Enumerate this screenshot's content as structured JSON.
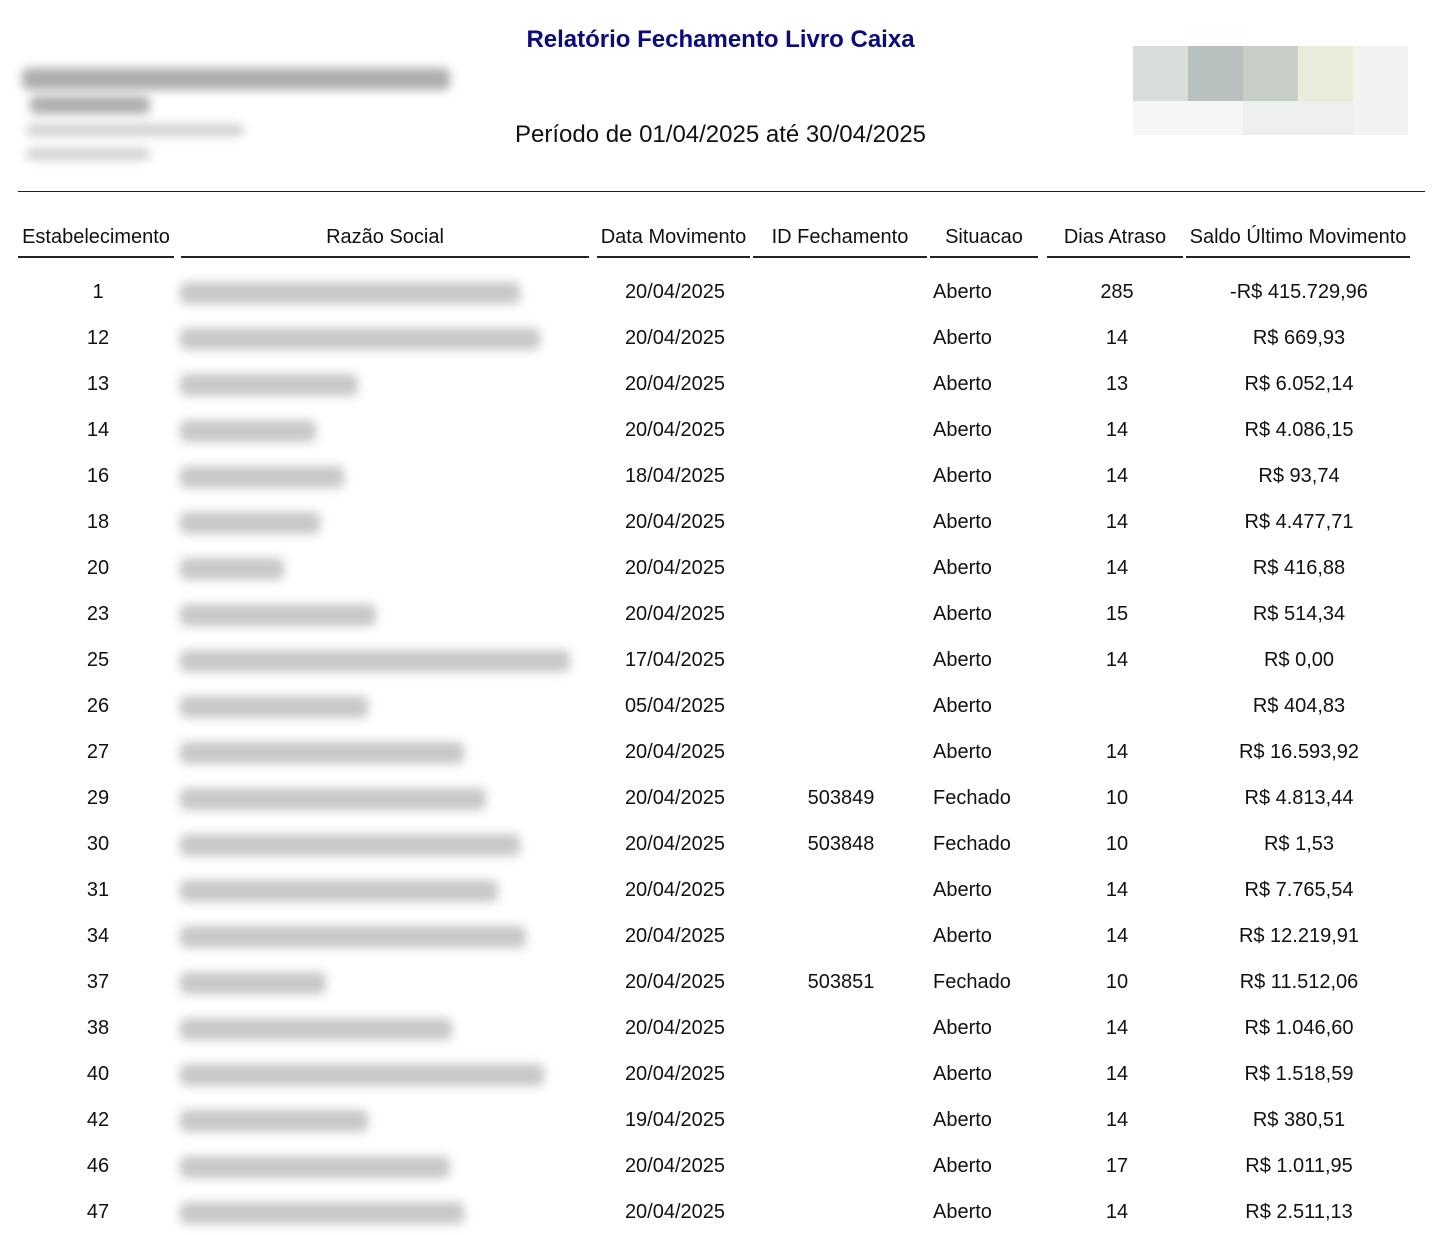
{
  "report": {
    "title": "Relatório Fechamento Livro Caixa",
    "period": "Período de 01/04/2025 até 30/04/2025"
  },
  "logo_colors": [
    "#d9ddda",
    "#b8c1c0",
    "#c8cfc9",
    "#e9ecda",
    "#f5f6f5",
    "#eef0ef",
    "#f2f3f1"
  ],
  "columns": {
    "estabelecimento": "Estabelecimento",
    "razao_social": "Razão Social",
    "data_movimento": "Data Movimento",
    "id_fechamento": "ID Fechamento",
    "situacao": "Situacao",
    "dias_atraso": "Dias Atraso",
    "saldo": "Saldo Último Movimento"
  },
  "rows": [
    {
      "estabelecimento": "1",
      "data": "20/04/2025",
      "id": "",
      "situacao": "Aberto",
      "dias": "285",
      "saldo": "-R$ 415.729,96"
    },
    {
      "estabelecimento": "12",
      "data": "20/04/2025",
      "id": "",
      "situacao": "Aberto",
      "dias": "14",
      "saldo": "R$ 669,93"
    },
    {
      "estabelecimento": "13",
      "data": "20/04/2025",
      "id": "",
      "situacao": "Aberto",
      "dias": "13",
      "saldo": "R$ 6.052,14"
    },
    {
      "estabelecimento": "14",
      "data": "20/04/2025",
      "id": "",
      "situacao": "Aberto",
      "dias": "14",
      "saldo": "R$ 4.086,15"
    },
    {
      "estabelecimento": "16",
      "data": "18/04/2025",
      "id": "",
      "situacao": "Aberto",
      "dias": "14",
      "saldo": "R$ 93,74"
    },
    {
      "estabelecimento": "18",
      "data": "20/04/2025",
      "id": "",
      "situacao": "Aberto",
      "dias": "14",
      "saldo": "R$ 4.477,71"
    },
    {
      "estabelecimento": "20",
      "data": "20/04/2025",
      "id": "",
      "situacao": "Aberto",
      "dias": "14",
      "saldo": "R$ 416,88"
    },
    {
      "estabelecimento": "23",
      "data": "20/04/2025",
      "id": "",
      "situacao": "Aberto",
      "dias": "15",
      "saldo": "R$ 514,34"
    },
    {
      "estabelecimento": "25",
      "data": "17/04/2025",
      "id": "",
      "situacao": "Aberto",
      "dias": "14",
      "saldo": "R$ 0,00"
    },
    {
      "estabelecimento": "26",
      "data": "05/04/2025",
      "id": "",
      "situacao": "Aberto",
      "dias": "",
      "saldo": "R$ 404,83"
    },
    {
      "estabelecimento": "27",
      "data": "20/04/2025",
      "id": "",
      "situacao": "Aberto",
      "dias": "14",
      "saldo": "R$ 16.593,92"
    },
    {
      "estabelecimento": "29",
      "data": "20/04/2025",
      "id": "503849",
      "situacao": "Fechado",
      "dias": "10",
      "saldo": "R$ 4.813,44"
    },
    {
      "estabelecimento": "30",
      "data": "20/04/2025",
      "id": "503848",
      "situacao": "Fechado",
      "dias": "10",
      "saldo": "R$ 1,53"
    },
    {
      "estabelecimento": "31",
      "data": "20/04/2025",
      "id": "",
      "situacao": "Aberto",
      "dias": "14",
      "saldo": "R$ 7.765,54"
    },
    {
      "estabelecimento": "34",
      "data": "20/04/2025",
      "id": "",
      "situacao": "Aberto",
      "dias": "14",
      "saldo": "R$ 12.219,91"
    },
    {
      "estabelecimento": "37",
      "data": "20/04/2025",
      "id": "503851",
      "situacao": "Fechado",
      "dias": "10",
      "saldo": "R$ 11.512,06"
    },
    {
      "estabelecimento": "38",
      "data": "20/04/2025",
      "id": "",
      "situacao": "Aberto",
      "dias": "14",
      "saldo": "R$ 1.046,60"
    },
    {
      "estabelecimento": "40",
      "data": "20/04/2025",
      "id": "",
      "situacao": "Aberto",
      "dias": "14",
      "saldo": "R$ 1.518,59"
    },
    {
      "estabelecimento": "42",
      "data": "19/04/2025",
      "id": "",
      "situacao": "Aberto",
      "dias": "14",
      "saldo": "R$ 380,51"
    },
    {
      "estabelecimento": "46",
      "data": "20/04/2025",
      "id": "",
      "situacao": "Aberto",
      "dias": "17",
      "saldo": "R$ 1.011,95"
    },
    {
      "estabelecimento": "47",
      "data": "20/04/2025",
      "id": "",
      "situacao": "Aberto",
      "dias": "14",
      "saldo": "R$ 2.511,13"
    }
  ]
}
